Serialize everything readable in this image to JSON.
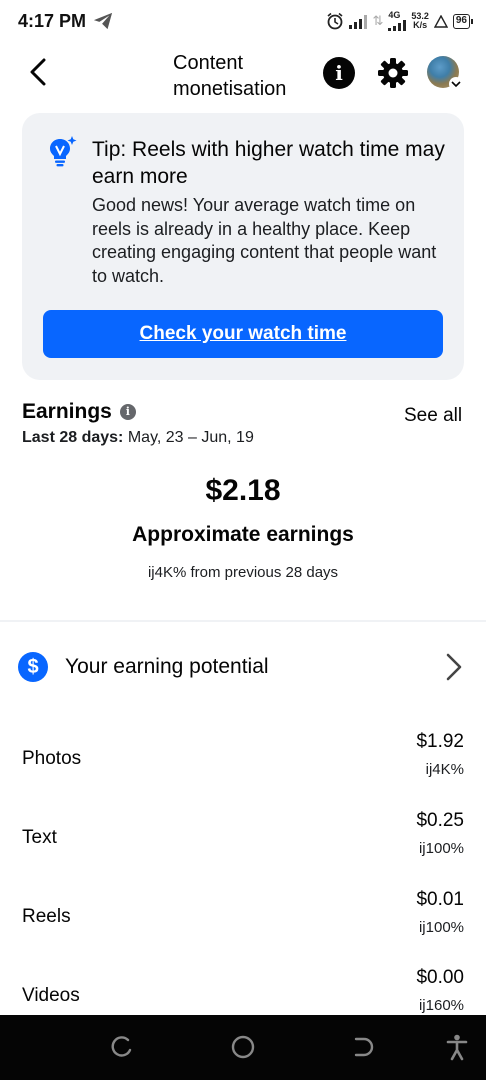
{
  "status_bar": {
    "time": "4:17 PM",
    "network": "4G",
    "speed_value": "53.2",
    "speed_unit": "K/s",
    "battery": "96"
  },
  "header": {
    "title": "Content monetisation",
    "icons": [
      "back-chevron-icon",
      "info-icon",
      "gear-icon",
      "avatar",
      "chevron-down-icon"
    ]
  },
  "tip": {
    "icon": "lightbulb-sparkle-icon",
    "title": "Tip: Reels with higher watch time may earn more",
    "body": "Good news! Your average watch time on reels is already in a healthy place. Keep creating engaging content that people want to watch.",
    "button_label": "Check your watch time"
  },
  "earnings": {
    "title": "Earnings",
    "see_all": "See all",
    "period_label": "Last 28 days:",
    "period_range": "May, 23 – Jun, 19",
    "amount": "$2.18",
    "amount_label": "Approximate earnings",
    "change_text": "ij4K% from previous 28 days"
  },
  "potential": {
    "icon": "dollar-icon",
    "label": "Your earning potential"
  },
  "breakdown": [
    {
      "label": "Photos",
      "value": "$1.92",
      "delta": "ij4K%"
    },
    {
      "label": "Text",
      "value": "$0.25",
      "delta": "ij100%"
    },
    {
      "label": "Reels",
      "value": "$0.01",
      "delta": "ij100%"
    },
    {
      "label": "Videos",
      "value": "$0.00",
      "delta": "ij160%"
    }
  ],
  "navbar": {
    "icons": [
      "recents-icon",
      "home-icon",
      "back-icon",
      "accessibility-icon"
    ]
  },
  "colors": {
    "accent": "#0866ff",
    "card_bg": "#f0f2f5",
    "text": "#050505",
    "navbar": "#050505"
  }
}
